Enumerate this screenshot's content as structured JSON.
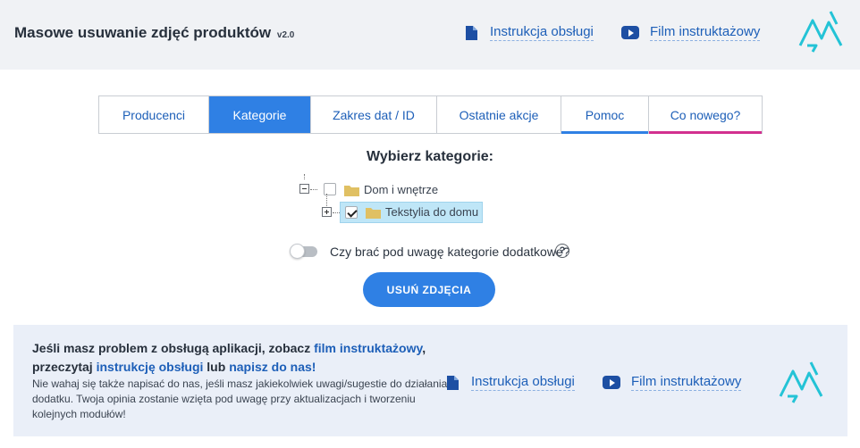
{
  "header": {
    "title": "Masowe usuwanie zdjęć produktów",
    "version": "v2.0",
    "manual_link": "Instrukcja obsługi",
    "video_link": "Film instruktażowy"
  },
  "tabs": [
    {
      "label": "Producenci"
    },
    {
      "label": "Kategorie"
    },
    {
      "label": "Zakres dat / ID"
    },
    {
      "label": "Ostatnie akcje"
    },
    {
      "label": "Pomoc"
    },
    {
      "label": "Co nowego?"
    }
  ],
  "active_tab": "Kategorie",
  "section_title": "Wybierz kategorie:",
  "tree": {
    "root": {
      "label": "Dom i wnętrze",
      "checked": false,
      "expanded": true
    },
    "child": {
      "label": "Tekstylia do domu",
      "checked": true,
      "expanded": false,
      "selected": true
    }
  },
  "extra_categories": {
    "label": "Czy brać pod uwagę kategorie dodatkowe?",
    "enabled": false,
    "help": "?"
  },
  "delete_button": "USUŃ ZDJĘCIA",
  "footer": {
    "head_1": "Jeśli masz problem z obsługą aplikacji, zobacz ",
    "head_link_1": "film instruktażowy",
    "head_2": ", przeczytaj ",
    "head_link_2": "instrukcję obsługi",
    "head_3": " lub ",
    "head_link_3": "napisz do nas!",
    "body": "Nie wahaj się także napisać do nas, jeśli masz jakiekolwiek uwagi/sugestie do działania dodatku. Twoja opinia zostanie wzięta pod uwagę przy aktualizacjach i tworzeniu kolejnych modułów!",
    "manual_link": "Instrukcja obsługi",
    "video_link": "Film instruktażowy"
  },
  "colors": {
    "accent": "#2f80e4",
    "link": "#1d5fb8",
    "header_bg": "#f0f2f5",
    "footer_bg": "#eaeff8",
    "pink": "#d2308f",
    "logo": "#23c3d6"
  }
}
